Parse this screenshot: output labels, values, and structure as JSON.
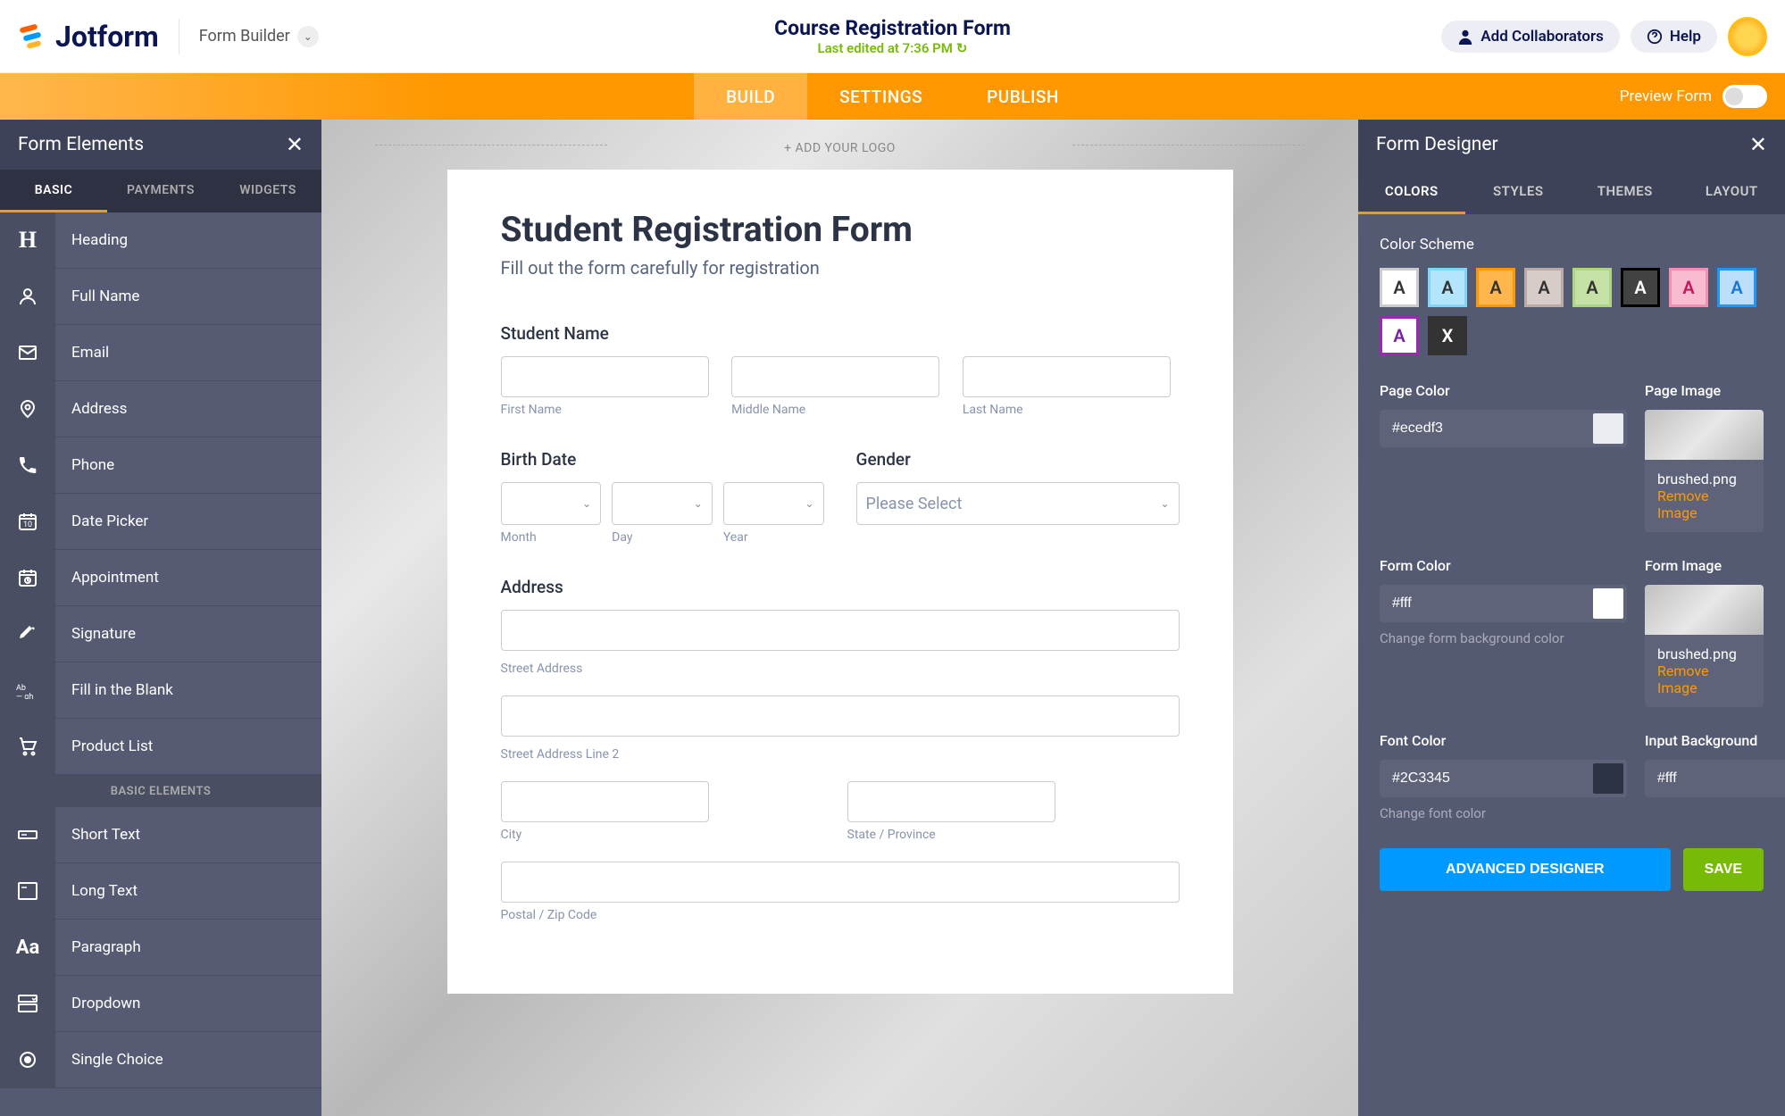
{
  "header": {
    "logo_text": "Jotform",
    "form_builder_label": "Form Builder",
    "form_title": "Course Registration Form",
    "last_edited": "Last edited at 7:36 PM",
    "add_collaborators": "Add Collaborators",
    "help": "Help"
  },
  "orange_nav": {
    "tabs": [
      "BUILD",
      "SETTINGS",
      "PUBLISH"
    ],
    "preview_label": "Preview Form"
  },
  "left_panel": {
    "title": "Form Elements",
    "tabs": [
      "BASIC",
      "PAYMENTS",
      "WIDGETS"
    ],
    "section_header": "BASIC ELEMENTS",
    "elements": [
      {
        "label": "Heading",
        "icon": "H"
      },
      {
        "label": "Full Name",
        "icon": "user"
      },
      {
        "label": "Email",
        "icon": "mail"
      },
      {
        "label": "Address",
        "icon": "pin"
      },
      {
        "label": "Phone",
        "icon": "phone"
      },
      {
        "label": "Date Picker",
        "icon": "calendar"
      },
      {
        "label": "Appointment",
        "icon": "appt"
      },
      {
        "label": "Signature",
        "icon": "sign"
      },
      {
        "label": "Fill in the Blank",
        "icon": "blank"
      },
      {
        "label": "Product List",
        "icon": "cart"
      }
    ],
    "elements2": [
      {
        "label": "Short Text",
        "icon": "short"
      },
      {
        "label": "Long Text",
        "icon": "long"
      },
      {
        "label": "Paragraph",
        "icon": "para"
      },
      {
        "label": "Dropdown",
        "icon": "drop"
      },
      {
        "label": "Single Choice",
        "icon": "radio"
      }
    ]
  },
  "canvas": {
    "add_logo": "+ ADD YOUR LOGO",
    "form_heading": "Student Registration Form",
    "form_subheading": "Fill out the form carefully for registration",
    "student_name_label": "Student Name",
    "first_name_sub": "First Name",
    "middle_name_sub": "Middle Name",
    "last_name_sub": "Last Name",
    "birth_date_label": "Birth Date",
    "month_sub": "Month",
    "day_sub": "Day",
    "year_sub": "Year",
    "gender_label": "Gender",
    "gender_placeholder": "Please Select",
    "address_label": "Address",
    "street_sub": "Street Address",
    "street2_sub": "Street Address Line 2",
    "city_sub": "City",
    "state_sub": "State / Province",
    "postal_sub": "Postal / Zip Code"
  },
  "right_panel": {
    "title": "Form Designer",
    "tabs": [
      "COLORS",
      "STYLES",
      "THEMES",
      "LAYOUT"
    ],
    "color_scheme_label": "Color Scheme",
    "schemes": [
      {
        "bg": "#ffffff",
        "fg": "#333",
        "border": "#ccc"
      },
      {
        "bg": "#b3e5fc",
        "fg": "#333",
        "border": "#81d4fa"
      },
      {
        "bg": "#ffb74d",
        "fg": "#333",
        "border": "#ff9800"
      },
      {
        "bg": "#d7ccc8",
        "fg": "#333",
        "border": "#bcaaa4"
      },
      {
        "bg": "#c5e1a5",
        "fg": "#333",
        "border": "#aed581"
      },
      {
        "bg": "#424242",
        "fg": "#fff",
        "border": "#000"
      },
      {
        "bg": "#f8bbd0",
        "fg": "#c2185b",
        "border": "#f48fb1"
      },
      {
        "bg": "#bbdefb",
        "fg": "#1976d2",
        "border": "#2196f3"
      },
      {
        "bg": "#ffffff",
        "fg": "#7b1fa2",
        "border": "#9c27b0"
      },
      {
        "bg": "#333",
        "fg": "#fff",
        "border": "#333",
        "letter": "X"
      }
    ],
    "page_color_label": "Page Color",
    "page_color_value": "#ecedf3",
    "page_color_swatch": "#ecedf3",
    "page_image_label": "Page Image",
    "page_image_name": "brushed.png",
    "remove_image": "Remove Image",
    "form_color_label": "Form Color",
    "form_color_value": "#fff",
    "form_color_swatch": "#ffffff",
    "form_color_help": "Change form background color",
    "form_image_label": "Form Image",
    "form_image_name": "brushed.png",
    "font_color_label": "Font Color",
    "font_color_value": "#2C3345",
    "font_color_swatch": "#2C3345",
    "font_color_help": "Change font color",
    "input_bg_label": "Input Background",
    "input_bg_value": "#fff",
    "input_bg_swatch": "#ffffff",
    "advanced_btn": "ADVANCED DESIGNER",
    "save_btn": "SAVE"
  }
}
